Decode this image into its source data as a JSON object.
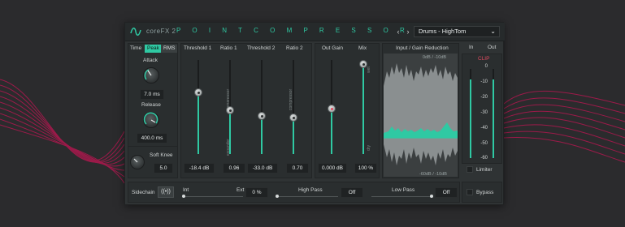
{
  "header": {
    "brand": "coreFX 2",
    "title": "P O I N T   C O M P R E S S O R",
    "nav_prev": "‹",
    "nav_next": "›",
    "preset": "Drums - HighTom",
    "in_label": "In",
    "out_label": "Out"
  },
  "time": {
    "label": "Time",
    "modes": [
      "Peak",
      "RMS"
    ],
    "active_mode": "Peak",
    "attack_label": "Attack",
    "attack_value": "7.0 ms",
    "release_label": "Release",
    "release_value": "400.0 ms",
    "softknee_label": "Soft Knee",
    "softknee_value": "5.0"
  },
  "columns": {
    "threshold1": "Threshold 1",
    "ratio1": "Ratio 1",
    "threshold2": "Threshold 2",
    "ratio2": "Ratio 2",
    "outgain": "Out Gain",
    "mix": "Mix",
    "gr_title": "Input / Gain Reduction"
  },
  "values": {
    "threshold1": "-18.4 dB",
    "ratio1": "0.96",
    "threshold2": "-33.0 dB",
    "ratio2": "0.70",
    "outgain": "0.000 dB",
    "mix": "100 %"
  },
  "slider_labels": {
    "compressor": "compressor",
    "expander": "expander",
    "wet": "wet",
    "dry": "dry"
  },
  "gr_scale": {
    "top": "0dB / -10dB",
    "bottom": "-60dB / -10dB"
  },
  "meter": {
    "clip": "CLIP",
    "scale": [
      "0",
      "-10",
      "-20",
      "-30",
      "-40",
      "-50",
      "-60"
    ],
    "limiter": "Limiter",
    "bypass": "Bypass"
  },
  "sidechain": {
    "label": "Sidechain",
    "int": "Int",
    "ext": "Ext",
    "mix_value": "0 %",
    "highpass": "High Pass",
    "highpass_value": "Off",
    "lowpass": "Low Pass",
    "lowpass_value": "Off"
  },
  "colors": {
    "accent": "#2fc9a3",
    "waves": "#c2185b",
    "clip": "#e04a5f"
  }
}
